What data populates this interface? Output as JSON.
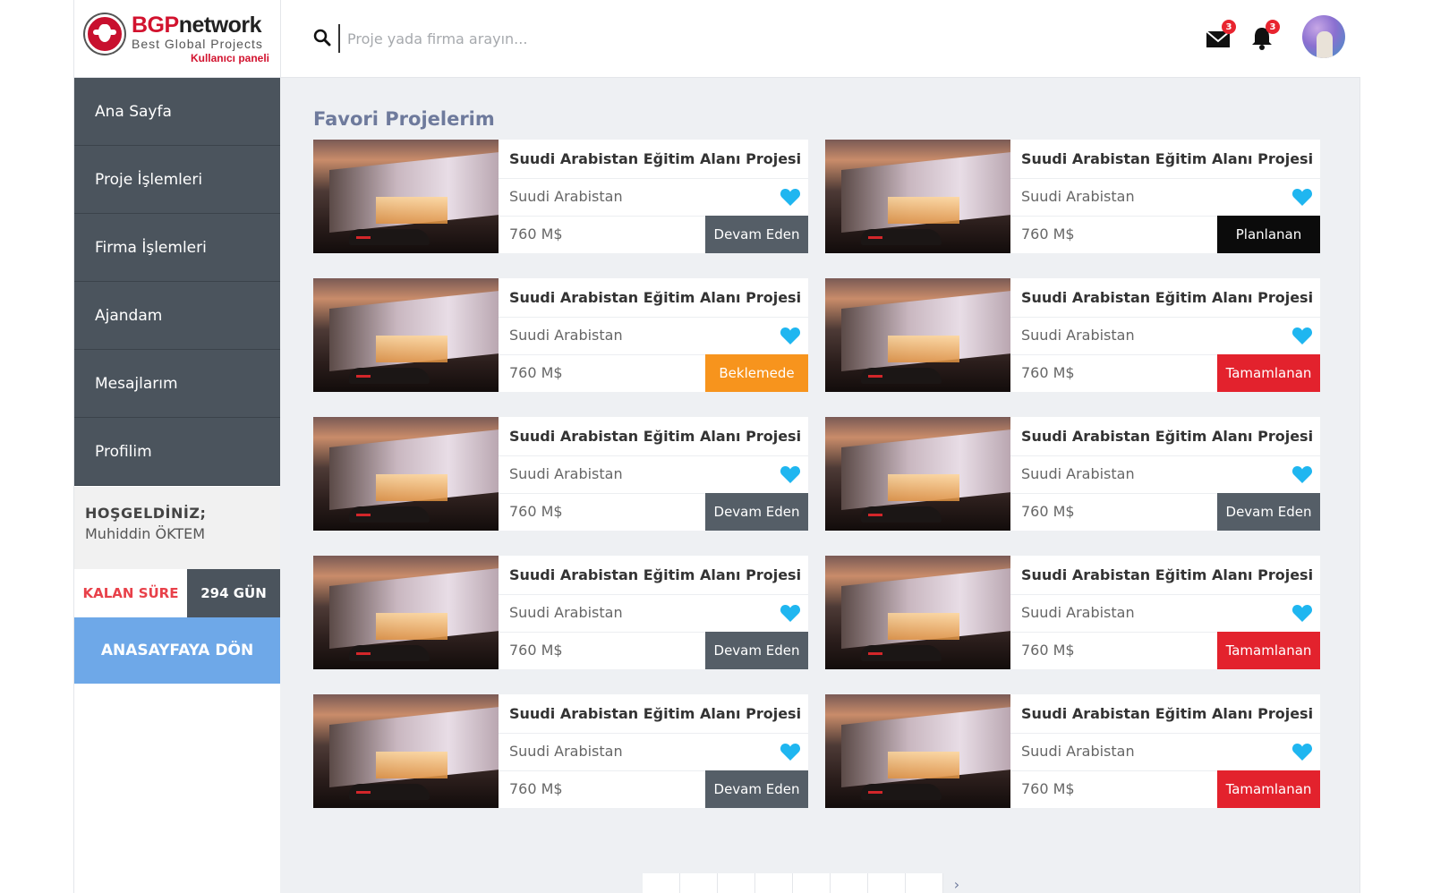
{
  "brand": {
    "name_bold": "BGP",
    "name_rest": "network",
    "tagline": "Best Global Projects",
    "panel": "Kullanıcı paneli",
    "colors": {
      "brand_red": "#d2122e",
      "sidebar": "#4b545d",
      "accent_blue": "#6ea8e8"
    }
  },
  "sidebar": {
    "items": [
      {
        "label": "Ana Sayfa"
      },
      {
        "label": "Proje İşlemleri"
      },
      {
        "label": "Firma İşlemleri"
      },
      {
        "label": "Ajandam"
      },
      {
        "label": "Mesajlarım"
      },
      {
        "label": "Profilim"
      }
    ],
    "welcome_title": "HOŞGELDİNİZ;",
    "welcome_name": "Muhiddin ÖKTEM",
    "remaining_label": "KALAN SÜRE",
    "remaining_value": "294 GÜN",
    "home_button": "ANASAYFAYA DÖN"
  },
  "header": {
    "search_placeholder": "Proje yada firma arayın...",
    "messages_icon": "envelope-icon",
    "messages_count": "3",
    "notifications_icon": "bell-icon",
    "notifications_count": "3"
  },
  "main": {
    "title": "Favori Projelerim",
    "status_colors": {
      "Devam Eden": "#555e67",
      "Planlanan": "#0b0b0b",
      "Beklemede": "#f7941d",
      "Tamamlanan": "#e3222d"
    },
    "projects": [
      {
        "title": "Suudi Arabistan Eğitim Alanı Projesi",
        "location": "Suudi Arabistan",
        "price": "760 M$",
        "status": "Devam Eden"
      },
      {
        "title": "Suudi Arabistan Eğitim Alanı Projesi",
        "location": "Suudi Arabistan",
        "price": "760 M$",
        "status": "Planlanan"
      },
      {
        "title": "Suudi Arabistan Eğitim Alanı Projesi",
        "location": "Suudi Arabistan",
        "price": "760 M$",
        "status": "Beklemede"
      },
      {
        "title": "Suudi Arabistan Eğitim Alanı Projesi",
        "location": "Suudi Arabistan",
        "price": "760 M$",
        "status": "Tamamlanan"
      },
      {
        "title": "Suudi Arabistan Eğitim Alanı Projesi",
        "location": "Suudi Arabistan",
        "price": "760 M$",
        "status": "Devam Eden"
      },
      {
        "title": "Suudi Arabistan Eğitim Alanı Projesi",
        "location": "Suudi Arabistan",
        "price": "760 M$",
        "status": "Devam Eden"
      },
      {
        "title": "Suudi Arabistan Eğitim Alanı Projesi",
        "location": "Suudi Arabistan",
        "price": "760 M$",
        "status": "Devam Eden"
      },
      {
        "title": "Suudi Arabistan Eğitim Alanı Projesi",
        "location": "Suudi Arabistan",
        "price": "760 M$",
        "status": "Tamamlanan"
      },
      {
        "title": "Suudi Arabistan Eğitim Alanı Projesi",
        "location": "Suudi Arabistan",
        "price": "760 M$",
        "status": "Devam Eden"
      },
      {
        "title": "Suudi Arabistan Eğitim Alanı Projesi",
        "location": "Suudi Arabistan",
        "price": "760 M$",
        "status": "Tamamlanan"
      }
    ],
    "heart_icon": "heart-icon",
    "heart_color": "#1fb6f0"
  },
  "pagination": {
    "next_icon": "chevron-right-icon",
    "next_glyph": "›"
  }
}
